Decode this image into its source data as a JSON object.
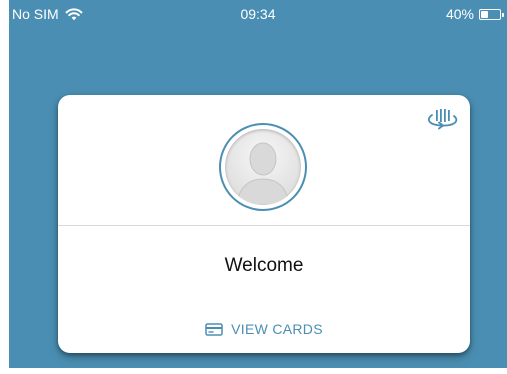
{
  "status_bar": {
    "carrier": "No SIM",
    "time": "09:34",
    "battery": "40%",
    "battery_level": 0.4,
    "wifi_icon": "wifi-icon",
    "battery_icon": "battery-icon"
  },
  "card": {
    "flip_icon": "card-flip-icon",
    "avatar_icon": "user-avatar-icon",
    "welcome_text": "Welcome",
    "view_cards_label": "VIEW CARDS",
    "view_cards_icon": "credit-card-icon"
  },
  "colors": {
    "background": "#4a8fb3",
    "accent": "#4a8fb3",
    "card": "#ffffff",
    "text": "#111111"
  }
}
